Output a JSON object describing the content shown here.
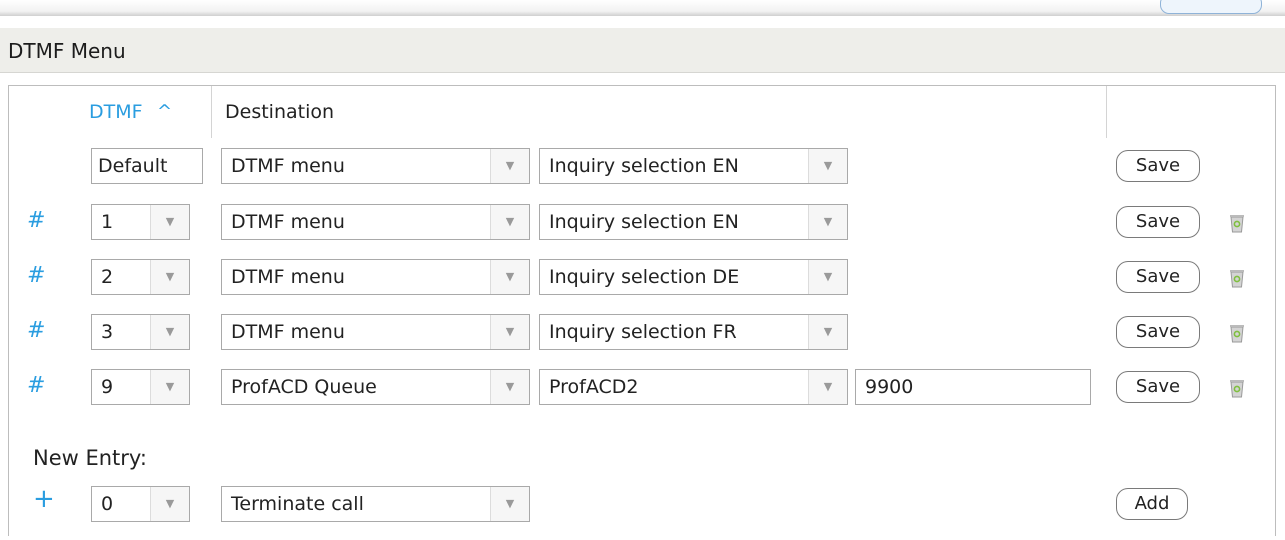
{
  "panel": {
    "title": "DTMF Menu"
  },
  "table": {
    "headers": {
      "dtmf": "DTMF",
      "sort_caret": "^",
      "destination": "Destination"
    },
    "default_row": {
      "dtmf": "Default",
      "destination_type": "DTMF menu",
      "destination_target": "Inquiry selection EN",
      "save_label": "Save"
    },
    "rows": [
      {
        "hash": "#",
        "dtmf": "1",
        "destination_type": "DTMF menu",
        "destination_target": "Inquiry selection EN",
        "extra": "",
        "save_label": "Save"
      },
      {
        "hash": "#",
        "dtmf": "2",
        "destination_type": "DTMF menu",
        "destination_target": "Inquiry selection DE",
        "extra": "",
        "save_label": "Save"
      },
      {
        "hash": "#",
        "dtmf": "3",
        "destination_type": "DTMF menu",
        "destination_target": "Inquiry selection FR",
        "extra": "",
        "save_label": "Save"
      },
      {
        "hash": "#",
        "dtmf": "9",
        "destination_type": "ProfACD Queue",
        "destination_target": "ProfACD2",
        "extra": "9900",
        "save_label": "Save"
      }
    ]
  },
  "new_entry": {
    "label": "New Entry:",
    "plus": "+",
    "dtmf": "0",
    "destination_type": "Terminate call",
    "add_label": "Add"
  },
  "icons": {
    "select_arrow": "▼",
    "trash": "trash-icon",
    "sort": "caret-up-icon",
    "add": "plus-icon"
  },
  "colors": {
    "accent": "#2a9de0",
    "header_bg": "#eeeeea",
    "trash_green": "#7fbf3f"
  }
}
